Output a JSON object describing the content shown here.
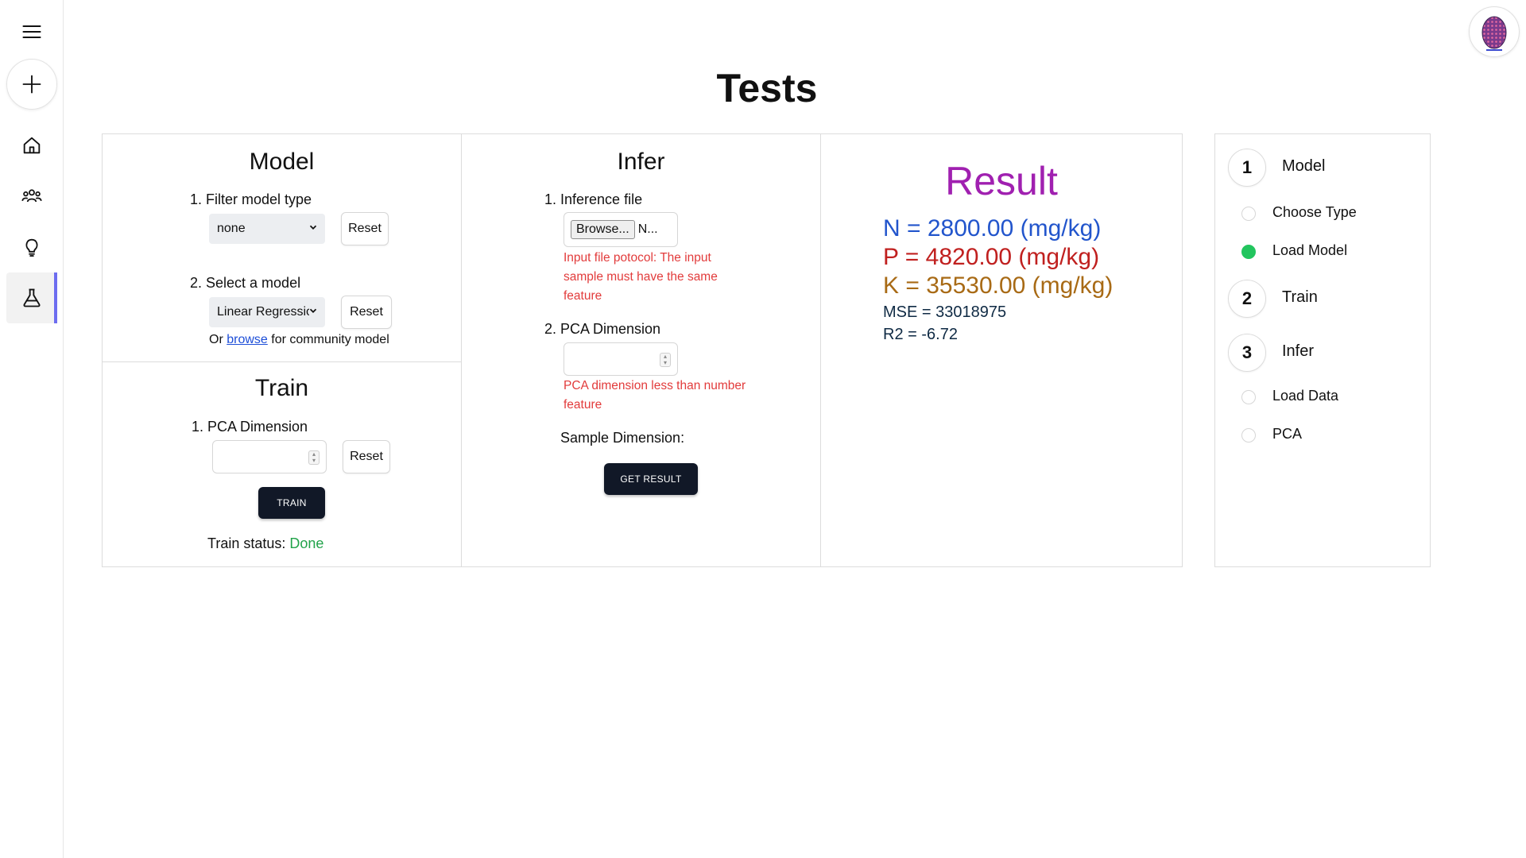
{
  "page": {
    "title": "Tests"
  },
  "sidebar": {
    "items": [
      {
        "name": "menu",
        "icon": "hamburger-menu-icon"
      },
      {
        "name": "add",
        "icon": "plus-icon"
      },
      {
        "name": "home",
        "icon": "home-icon"
      },
      {
        "name": "team",
        "icon": "people-icon"
      },
      {
        "name": "ideas",
        "icon": "lightbulb-icon"
      },
      {
        "name": "tests",
        "icon": "flask-icon",
        "active": true
      }
    ],
    "accent": "#6d6df0"
  },
  "model": {
    "heading": "Model",
    "filter_label": "1. Filter model type",
    "filter_value": "none",
    "filter_reset": "Reset",
    "select_label": "2. Select a model",
    "select_value": "Linear Regression",
    "select_reset": "Reset",
    "or_text": "Or",
    "browse_link": "browse",
    "community_text": "for community model"
  },
  "train": {
    "heading": "Train",
    "pca_label": "1. PCA Dimension",
    "pca_value": "",
    "reset": "Reset",
    "train_button": "TRAIN",
    "status_label": "Train status:",
    "status_value": "Done"
  },
  "infer": {
    "heading": "Infer",
    "file_label": "1. Inference file",
    "browse_button": "Browse...",
    "file_name": "N...",
    "file_error": "Input file potocol: The input sample must have the same feature",
    "pca_label": "2. PCA Dimension",
    "pca_value": "",
    "pca_error": "PCA dimension less than number feature",
    "sample_dimension_label": "Sample Dimension:",
    "get_result_button": "GET RESULT"
  },
  "result": {
    "heading": "Result",
    "n_line": "N = 2800.00 (mg/kg)",
    "p_line": "P = 4820.00 (mg/kg)",
    "k_line": "K = 35530.00 (mg/kg)",
    "mse_line": "MSE = 33018975",
    "r2_line": "R2 = -6.72",
    "colors": {
      "title": "#a020b0",
      "n": "#2255cc",
      "p": "#c0201f",
      "k": "#a86a15"
    }
  },
  "steps": {
    "items": [
      {
        "number": "1",
        "label": "Model"
      },
      {
        "number": "2",
        "label": "Train"
      },
      {
        "number": "3",
        "label": "Infer"
      }
    ],
    "model_sub": [
      {
        "label": "Choose Type",
        "done": false
      },
      {
        "label": "Load Model",
        "done": true
      }
    ],
    "infer_sub": [
      {
        "label": "Load Data",
        "done": false
      },
      {
        "label": "PCA",
        "done": false
      }
    ],
    "done_color": "#22c55e"
  }
}
